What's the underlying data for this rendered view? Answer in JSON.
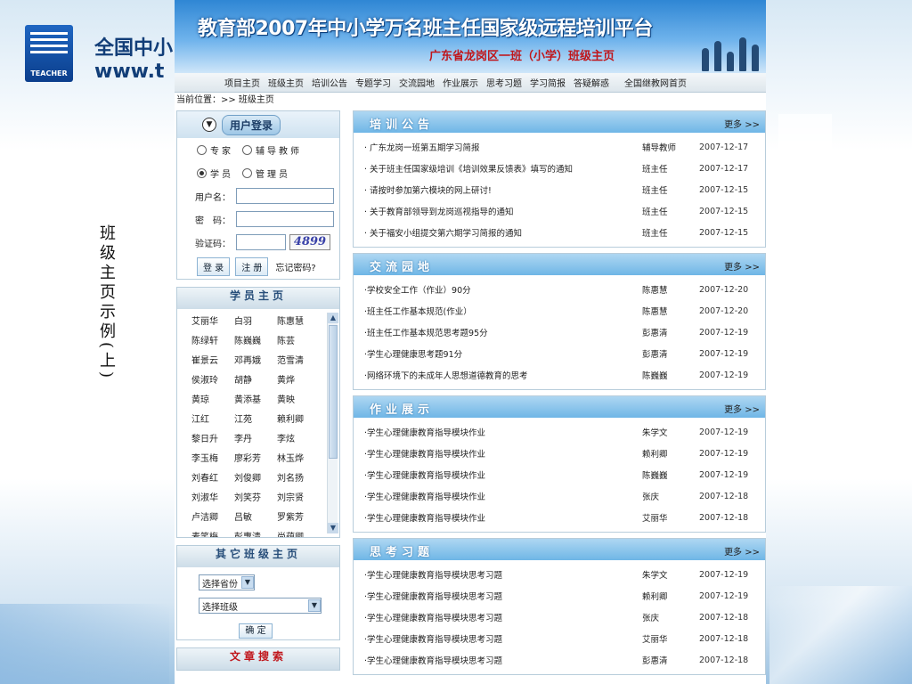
{
  "slide": {
    "logo_text": "TEACHER",
    "brand_line1": "全国中小",
    "brand_line2": "www.t",
    "caption": "班级主页示例(上)"
  },
  "site": {
    "banner_title": "教育部2007年中小学万名班主任国家级远程培训平台",
    "banner_subtitle": "广东省龙岗区一班（小学）班级主页",
    "nav": [
      "项目主页",
      "班级主页",
      "培训公告",
      "专题学习",
      "交流园地",
      "作业展示",
      "思考习题",
      "学习简报",
      "答疑解惑",
      "全国继教网首页"
    ],
    "breadcrumb": "当前位置：>> 班级主页",
    "login": {
      "title": "用户登录",
      "roles_row1": [
        {
          "label": "专家",
          "checked": false
        },
        {
          "label": "辅导教师",
          "checked": false
        }
      ],
      "roles_row2": [
        {
          "label": "学员",
          "checked": true
        },
        {
          "label": "管理员",
          "checked": false
        }
      ],
      "username_label": "用户名：",
      "password_label": "密　码：",
      "captcha_label": "验证码：",
      "captcha_code": "4899",
      "login_button": "登 录",
      "register_button": "注 册",
      "forgot_link": "忘记密码?"
    },
    "students": {
      "title": "学员主页",
      "names": [
        "艾丽华",
        "白羽",
        "陈惠慧",
        "陈绿轩",
        "陈巍巍",
        "陈芸",
        "崔景云",
        "邓再娥",
        "范雪清",
        "侯淑玲",
        "胡静",
        "黄烨",
        "黄琼",
        "黄添基",
        "黄映",
        "江红",
        "江苑",
        "赖利卿",
        "黎日升",
        "李丹",
        "李炫",
        "李玉梅",
        "廖彩芳",
        "林玉烨",
        "刘春红",
        "刘俊卿",
        "刘名扬",
        "刘淑华",
        "刘笑芬",
        "刘宗贤",
        "卢洁卿",
        "吕敏",
        "罗紫芳",
        "麦笑梅",
        "彭惠清",
        "尚蕴卿"
      ]
    },
    "other": {
      "title": "其它班级主页",
      "province_select": "选择省份",
      "class_select": "选择班级",
      "confirm_button": "确 定"
    },
    "search": {
      "title": "文章搜索"
    },
    "more_label": "更多 >>",
    "panels": [
      {
        "title": "培训公告",
        "rows": [
          {
            "title": "· 广东龙岗一班第五期学习简报",
            "author": "辅导教师",
            "date": "2007-12-17"
          },
          {
            "title": "· 关于班主任国家级培训《培训效果反馈表》填写的通知",
            "author": "班主任",
            "date": "2007-12-17"
          },
          {
            "title": "· 请按时参加第六模块的网上研讨!",
            "author": "班主任",
            "date": "2007-12-15"
          },
          {
            "title": "· 关于教育部领导到龙岗巡视指导的通知",
            "author": "班主任",
            "date": "2007-12-15"
          },
          {
            "title": "· 关于福安小组提交第六期学习简报的通知",
            "author": "班主任",
            "date": "2007-12-15"
          }
        ]
      },
      {
        "title": "交流园地",
        "rows": [
          {
            "title": "·学校安全工作（作业）90分",
            "author": "陈惠慧",
            "date": "2007-12-20"
          },
          {
            "title": "·班主任工作基本规范(作业）",
            "author": "陈惠慧",
            "date": "2007-12-20"
          },
          {
            "title": "·班主任工作基本规范思考题95分",
            "author": "彭惠清",
            "date": "2007-12-19"
          },
          {
            "title": "·学生心理健康思考题91分",
            "author": "彭惠清",
            "date": "2007-12-19"
          },
          {
            "title": "·网络环境下的未成年人思想道德教育的思考",
            "author": "陈巍巍",
            "date": "2007-12-19"
          }
        ]
      },
      {
        "title": "作业展示",
        "rows": [
          {
            "title": "·学生心理健康教育指导模块作业",
            "author": "朱学文",
            "date": "2007-12-19"
          },
          {
            "title": "·学生心理健康教育指导模块作业",
            "author": "赖利卿",
            "date": "2007-12-19"
          },
          {
            "title": "·学生心理健康教育指导模块作业",
            "author": "陈巍巍",
            "date": "2007-12-19"
          },
          {
            "title": "·学生心理健康教育指导模块作业",
            "author": "张庆",
            "date": "2007-12-18"
          },
          {
            "title": "·学生心理健康教育指导模块作业",
            "author": "艾丽华",
            "date": "2007-12-18"
          }
        ]
      },
      {
        "title": "思考习题",
        "rows": [
          {
            "title": "·学生心理健康教育指导模块思考习题",
            "author": "朱学文",
            "date": "2007-12-19"
          },
          {
            "title": "·学生心理健康教育指导模块思考习题",
            "author": "赖利卿",
            "date": "2007-12-19"
          },
          {
            "title": "·学生心理健康教育指导模块思考习题",
            "author": "张庆",
            "date": "2007-12-18"
          },
          {
            "title": "·学生心理健康教育指导模块思考习题",
            "author": "艾丽华",
            "date": "2007-12-18"
          },
          {
            "title": "·学生心理健康教育指导模块思考习题",
            "author": "彭惠清",
            "date": "2007-12-18"
          }
        ]
      }
    ]
  }
}
